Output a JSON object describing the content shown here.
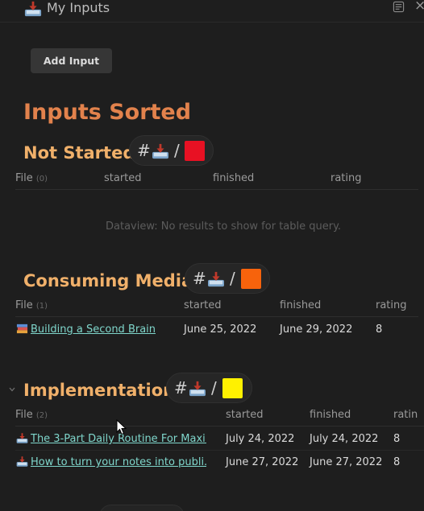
{
  "topbar": {
    "title": "My Inputs",
    "icon": "inbox-tray-icon",
    "reader_icon": "reading-view-icon",
    "close_label": "×"
  },
  "add_button": {
    "label": "Add Input"
  },
  "heading": "Inputs Sorted",
  "sections": [
    {
      "title": "Not Started",
      "tag": {
        "hash": "#",
        "slash": "/",
        "color": "#e81123"
      },
      "columns": {
        "file": "File",
        "count": "(0)",
        "started": "started",
        "finished": "finished",
        "rating": "rating"
      },
      "empty_message": "Dataview: No results to show for table query.",
      "rows": []
    },
    {
      "title": "Consuming Media",
      "tag": {
        "hash": "#",
        "slash": "/",
        "color": "#f7630c"
      },
      "columns": {
        "file": "File",
        "count": "(1)",
        "started": "started",
        "finished": "finished",
        "rating": "rating"
      },
      "rows": [
        {
          "file": "Building a Second Brain",
          "icon": "books-icon",
          "started": "June 25, 2022",
          "finished": "June 29, 2022",
          "rating": "8"
        }
      ]
    },
    {
      "title": "Implementation",
      "tag": {
        "hash": "#",
        "slash": "/",
        "color": "#fff100"
      },
      "columns": {
        "file": "File",
        "count": "(2)",
        "started": "started",
        "finished": "finished",
        "rating": "ratin"
      },
      "rows": [
        {
          "file": "The 3-Part Daily Routine For Maxi...",
          "icon": "inbox-tray-icon",
          "started": "July 24, 2022",
          "finished": "July 24, 2022",
          "rating": "8"
        },
        {
          "file": "How to turn your notes into publi...",
          "icon": "inbox-tray-icon",
          "started": "June 27, 2022",
          "finished": "June 27, 2022",
          "rating": "8"
        }
      ]
    }
  ],
  "colors": {
    "background": "#1e1e1e",
    "h1": "#e2824c",
    "h2": "#f0b06a",
    "link": "#7fd6cb"
  }
}
